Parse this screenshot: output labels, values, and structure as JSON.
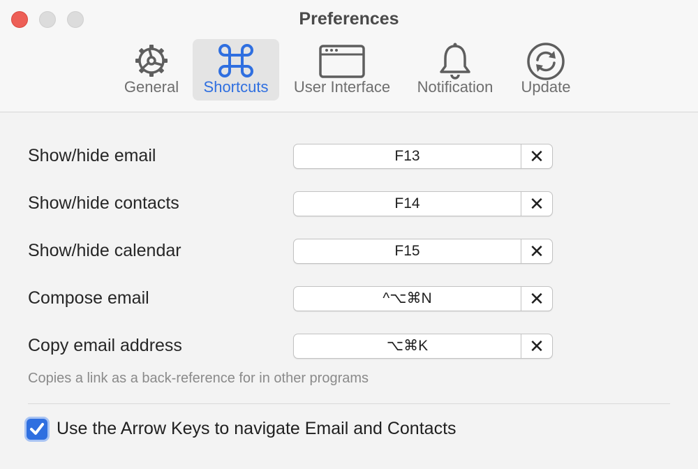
{
  "window": {
    "title": "Preferences"
  },
  "tabs": [
    {
      "label": "General",
      "icon": "gear-icon",
      "active": false
    },
    {
      "label": "Shortcuts",
      "icon": "command-icon",
      "active": true
    },
    {
      "label": "User Interface",
      "icon": "window-icon",
      "active": false
    },
    {
      "label": "Notification",
      "icon": "bell-icon",
      "active": false
    },
    {
      "label": "Update",
      "icon": "sync-icon",
      "active": false
    }
  ],
  "shortcuts": [
    {
      "label": "Show/hide email",
      "keys": "F13",
      "clear": "✕"
    },
    {
      "label": "Show/hide contacts",
      "keys": "F14",
      "clear": "✕"
    },
    {
      "label": "Show/hide calendar",
      "keys": "F15",
      "clear": "✕"
    },
    {
      "label": "Compose email",
      "keys": "^⌥⌘N",
      "clear": "✕"
    },
    {
      "label": "Copy email address",
      "keys": "⌥⌘K",
      "clear": "✕"
    }
  ],
  "hint": "Copies a link as a back-reference for in other programs",
  "arrow_keys": {
    "label": "Use the Arrow Keys to navigate Email and Contacts",
    "checked": true
  },
  "colors": {
    "accent": "#2f6fe0",
    "close": "#ed5f57"
  }
}
